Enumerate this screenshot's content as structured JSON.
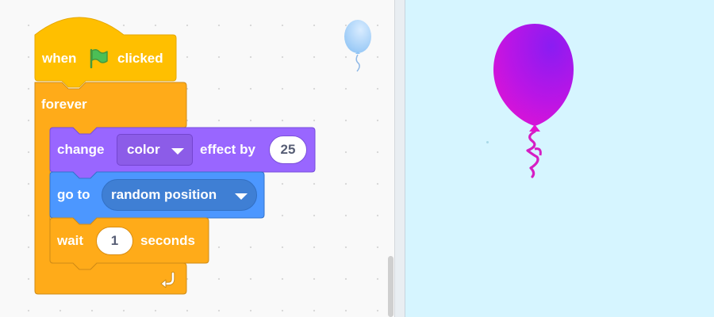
{
  "code_area": {
    "hat_block": {
      "label_before": "when",
      "flag_icon": "green-flag-icon",
      "label_after": "clicked"
    },
    "forever_block": {
      "label": "forever",
      "loop_icon": "loop-arrow-icon"
    },
    "change_effect_block": {
      "label": "change",
      "dropdown_value": "color",
      "label_after": "effect by",
      "amount": "25"
    },
    "goto_block": {
      "label": "go to",
      "dropdown_value": "random position"
    },
    "wait_block": {
      "label": "wait",
      "seconds": "1",
      "label_after": "seconds"
    },
    "sprite_thumbnail_icon": "balloon-icon"
  },
  "stage": {
    "sprite_icon": "balloon-icon",
    "background_color": "#d6f5ff",
    "balloon_colors": [
      "#8a1cf2",
      "#e214d2"
    ]
  },
  "colors": {
    "events": "#ffbf00",
    "control": "#ffab19",
    "looks": "#9966ff",
    "motion": "#4c97ff"
  }
}
